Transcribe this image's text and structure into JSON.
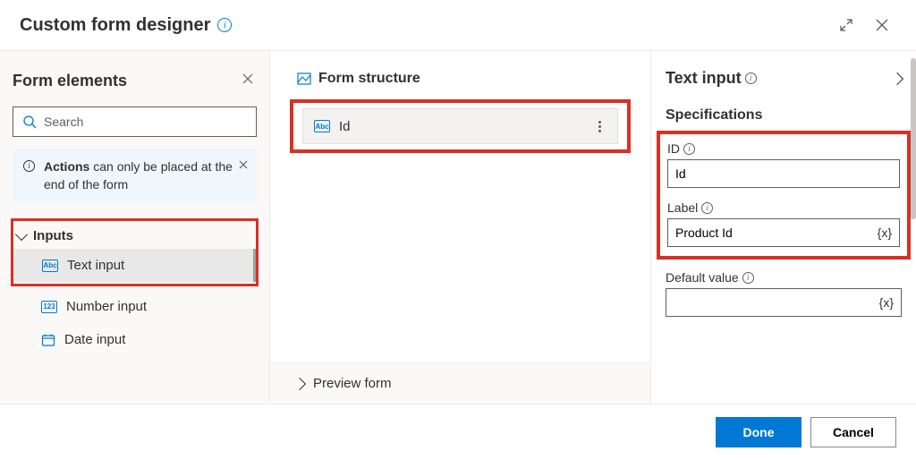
{
  "header": {
    "title": "Custom form designer"
  },
  "left": {
    "title": "Form elements",
    "search_placeholder": "Search",
    "banner_bold": "Actions",
    "banner_rest": " can only be placed at the end of the form",
    "group_inputs": "Inputs",
    "item_text": "Text input",
    "item_number": "Number input",
    "item_date": "Date input"
  },
  "mid": {
    "title": "Form structure",
    "card_label": "Id",
    "preview": "Preview form"
  },
  "right": {
    "title": "Text input",
    "spec_title": "Specifications",
    "id_label": "ID",
    "id_value": "Id",
    "label_label": "Label",
    "label_value": "Product Id",
    "default_label": "Default value",
    "default_value": ""
  },
  "footer": {
    "done": "Done",
    "cancel": "Cancel"
  }
}
